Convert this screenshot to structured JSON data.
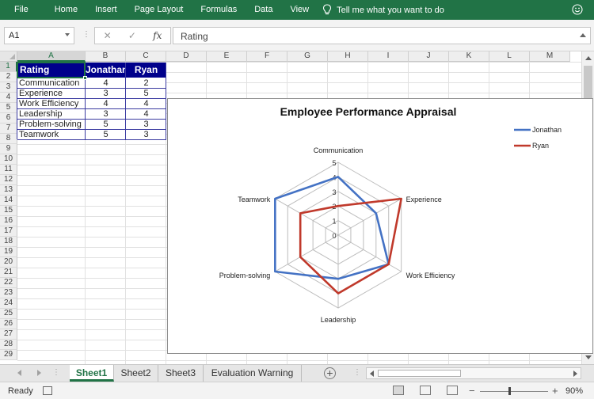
{
  "ribbon": {
    "tabs": [
      "File",
      "Home",
      "Insert",
      "Page Layout",
      "Formulas",
      "Data",
      "View"
    ],
    "tell_me": "Tell me what you want to do"
  },
  "formula_bar": {
    "name_box": "A1",
    "cancel_icon": "✕",
    "enter_icon": "✓",
    "fx_label": "fx",
    "content": "Rating"
  },
  "columns": [
    "A",
    "B",
    "C",
    "D",
    "E",
    "F",
    "G",
    "H",
    "I",
    "J",
    "K",
    "L",
    "M"
  ],
  "rows": [
    "1",
    "2",
    "3",
    "4",
    "5",
    "6",
    "7",
    "8",
    "9",
    "10",
    "11",
    "12",
    "13",
    "14",
    "15",
    "16",
    "17",
    "18",
    "19",
    "20",
    "21",
    "22",
    "23",
    "24",
    "25",
    "26",
    "27",
    "28",
    "29"
  ],
  "table": {
    "headers": [
      "Rating",
      "Jonathan",
      "Ryan"
    ],
    "rows": [
      {
        "label": "Communication",
        "jonathan": "4",
        "ryan": "2"
      },
      {
        "label": "Experience",
        "jonathan": "3",
        "ryan": "5"
      },
      {
        "label": "Work Efficiency",
        "jonathan": "4",
        "ryan": "4"
      },
      {
        "label": "Leadership",
        "jonathan": "3",
        "ryan": "4"
      },
      {
        "label": "Problem-solving",
        "jonathan": "5",
        "ryan": "3"
      },
      {
        "label": "Teamwork",
        "jonathan": "5",
        "ryan": "3"
      }
    ]
  },
  "chart_data": {
    "type": "radar",
    "title": "Employee Performance Appraisal",
    "categories": [
      "Communication",
      "Experience",
      "Work Efficiency",
      "Leadership",
      "Problem-solving",
      "Teamwork"
    ],
    "series": [
      {
        "name": "Jonathan",
        "values": [
          4,
          3,
          4,
          3,
          5,
          5
        ],
        "color": "#4472c4"
      },
      {
        "name": "Ryan",
        "values": [
          2,
          5,
          4,
          4,
          3,
          3
        ],
        "color": "#c0392b"
      }
    ],
    "axis_ticks": [
      "0",
      "1",
      "2",
      "3",
      "4",
      "5"
    ],
    "range": [
      0,
      5
    ],
    "legend_position": "top-right",
    "grid": true
  },
  "sheet_tabs": [
    "Sheet1",
    "Sheet2",
    "Sheet3",
    "Evaluation Warning"
  ],
  "active_sheet": "Sheet1",
  "status": {
    "ready": "Ready",
    "zoom": "90%",
    "zoom_minus": "−",
    "zoom_plus": "+"
  },
  "colors": {
    "excel_green": "#217346",
    "header_fill": "#00008b"
  }
}
